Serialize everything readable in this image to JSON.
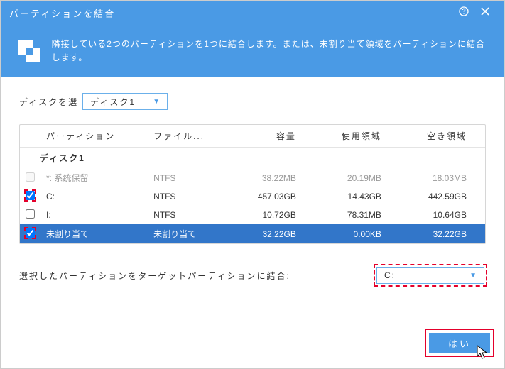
{
  "title": "パーティションを結合",
  "banner": "隣接している2つのパーティションを1つに結合します。または、未割り当て領域をパーティションに結合します。",
  "disk_label": "ディスクを選",
  "disk_selected": "ディスク1",
  "columns": {
    "partition": "パーティション",
    "fs": "ファイル...",
    "size": "容量",
    "used": "使用領域",
    "free": "空き領域"
  },
  "group": "ディスク1",
  "rows": [
    {
      "name": "*: 系统保留",
      "fs": "NTFS",
      "size": "38.22MB",
      "used": "20.19MB",
      "free": "18.03MB",
      "checked": false,
      "disabled": true,
      "selected": false,
      "marked": false
    },
    {
      "name": "C:",
      "fs": "NTFS",
      "size": "457.03GB",
      "used": "14.43GB",
      "free": "442.59GB",
      "checked": true,
      "disabled": false,
      "selected": false,
      "marked": true
    },
    {
      "name": "I:",
      "fs": "NTFS",
      "size": "10.72GB",
      "used": "78.31MB",
      "free": "10.64GB",
      "checked": false,
      "disabled": false,
      "selected": false,
      "marked": false
    },
    {
      "name": "未割り当て",
      "fs": "未割り当て",
      "size": "32.22GB",
      "used": "0.00KB",
      "free": "32.22GB",
      "checked": true,
      "disabled": false,
      "selected": true,
      "marked": true
    }
  ],
  "target_label": "選択したパーティションをターゲットパーティションに結合:",
  "target_value": "C:",
  "ok": "はい"
}
